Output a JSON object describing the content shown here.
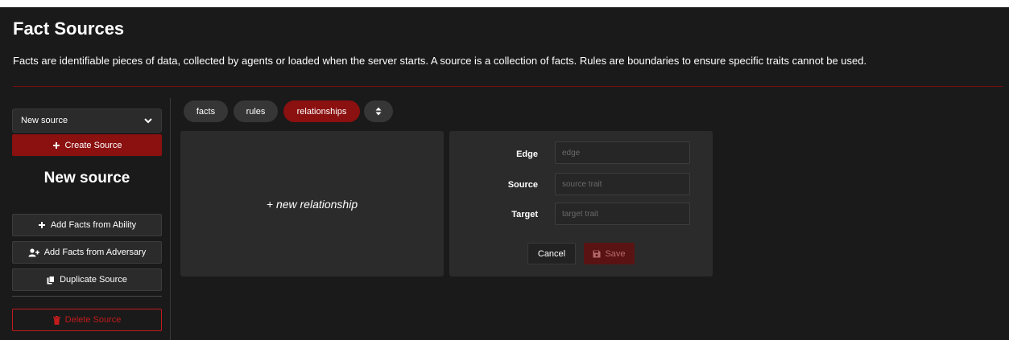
{
  "header": {
    "title": "Fact Sources",
    "description": "Facts are identifiable pieces of data, collected by agents or loaded when the server starts. A source is a collection of facts. Rules are boundaries to ensure specific traits cannot be used."
  },
  "sidebar": {
    "source_select": {
      "value": "New source"
    },
    "create_label": "Create Source",
    "source_name": "New source",
    "add_from_ability_label": "Add Facts from Ability",
    "add_from_adversary_label": "Add Facts from Adversary",
    "duplicate_label": "Duplicate Source",
    "delete_label": "Delete Source"
  },
  "tabs": [
    {
      "label": "facts",
      "active": false
    },
    {
      "label": "rules",
      "active": false
    },
    {
      "label": "relationships",
      "active": true
    }
  ],
  "sort_icon": "sort-icon",
  "new_relationship_label": "+ new relationship",
  "form": {
    "edge": {
      "label": "Edge",
      "placeholder": "edge",
      "value": ""
    },
    "source": {
      "label": "Source",
      "placeholder": "source trait",
      "value": ""
    },
    "target": {
      "label": "Target",
      "placeholder": "target trait",
      "value": ""
    },
    "cancel_label": "Cancel",
    "save_label": "Save"
  },
  "colors": {
    "background": "#1a1a1a",
    "accent": "#8b1010",
    "danger": "#c21b1b",
    "panel": "#2b2b2b"
  }
}
